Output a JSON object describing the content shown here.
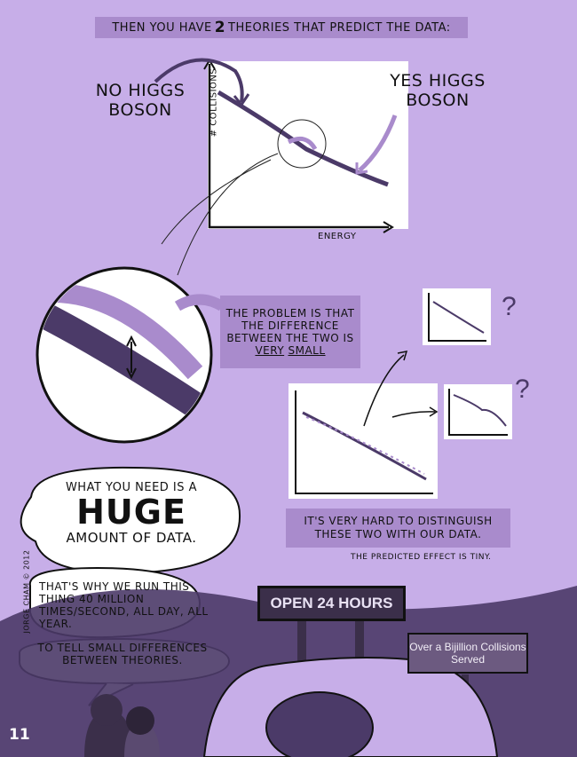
{
  "caption_top": {
    "pre": "THEN YOU HAVE",
    "num": "2",
    "post": "THEORIES THAT PREDICT THE DATA:"
  },
  "graph": {
    "label_no_higgs": "NO HIGGS BOSON",
    "label_yes_higgs": "YES HIGGS BOSON",
    "y_axis": "# COLLISIONS",
    "x_axis": "ENERGY"
  },
  "problem": {
    "line1": "THE PROBLEM IS THAT THE DIFFERENCE BETWEEN THE TWO IS",
    "very": "VERY",
    "small": "SMALL"
  },
  "hard_caption": "IT'S VERY HARD TO DISTINGUISH THESE TWO WITH OUR DATA.",
  "tiny_caption": "THE PREDICTED EFFECT IS TINY.",
  "bubble_huge": {
    "pre": "WHAT YOU NEED IS A",
    "big": "HUGE",
    "post": "AMOUNT OF DATA."
  },
  "bubble_40m": "THAT'S WHY WE RUN THIS THING 40 MILLION TIMES/SECOND, ALL DAY, ALL YEAR.",
  "bubble_small_diff": "TO TELL SMALL DIFFERENCES BETWEEN THEORIES.",
  "signature": "JORGE CHAM © 2012",
  "page_number": "11",
  "sign_open": "OPEN 24 HOURS",
  "sign_bijillion": "Over a Bijillion Collisions Served",
  "question_marks": [
    "?",
    "?"
  ],
  "colors": {
    "bg": "#c7aee8",
    "panel": "#ffffff",
    "dark": "#4b3a68",
    "light": "#a98bcc",
    "bubble": "#ffffff"
  }
}
